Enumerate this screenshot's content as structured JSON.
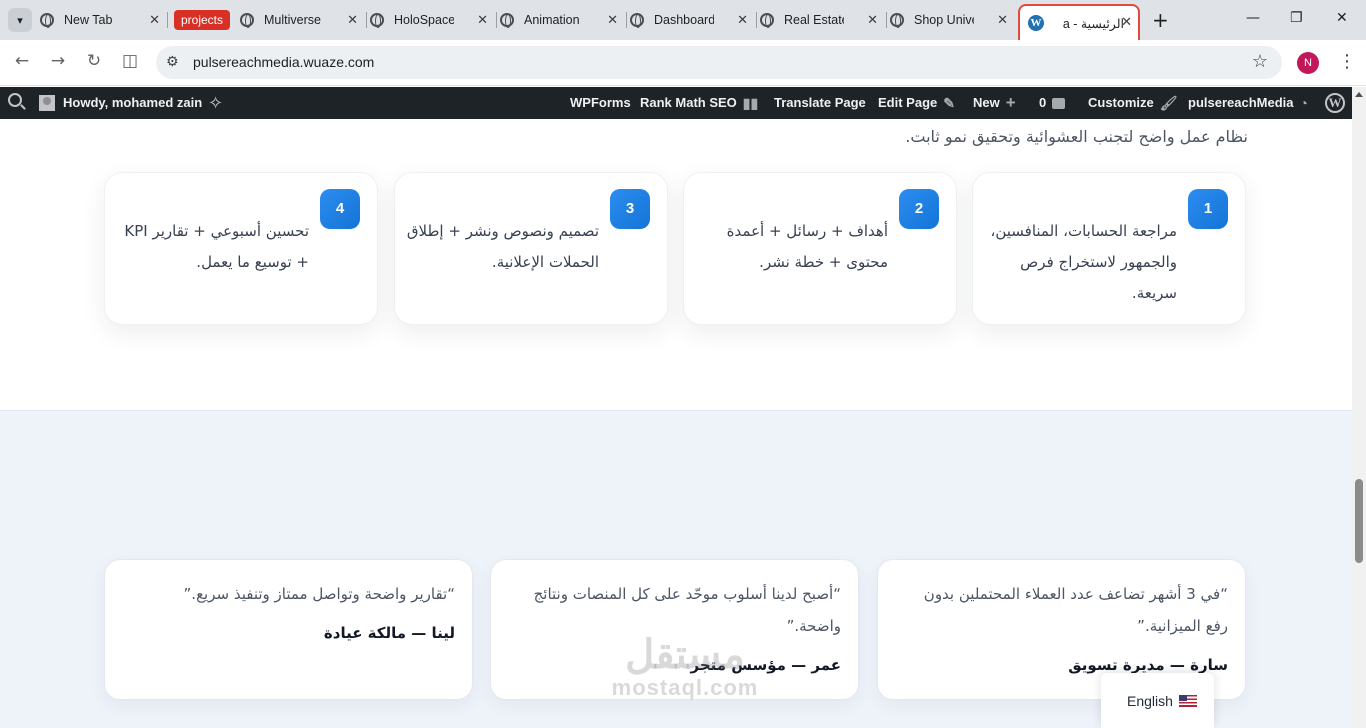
{
  "browser": {
    "tabs": [
      {
        "title": "New Tab"
      },
      {
        "title": "Multiverse"
      },
      {
        "title": "HoloSpace"
      },
      {
        "title": "Animation"
      },
      {
        "title": "Dashboard"
      },
      {
        "title": "Real Estate"
      },
      {
        "title": "Shop Unive"
      },
      {
        "title": "الرئيسية - a",
        "active": true
      }
    ],
    "group_chip": "projects",
    "new_tab": "+",
    "url": "pulsereachmedia.wuaze.com",
    "profile_initial": "N"
  },
  "adminbar": {
    "howdy": "Howdy, mohamed zain",
    "wpforms": "WPForms",
    "rankmath": "Rank Math SEO",
    "translate": "Translate Page",
    "edit": "Edit Page",
    "new": "New",
    "comments_count": "0",
    "customize": "Customize",
    "site": "pulsereachMedia"
  },
  "process": {
    "intro": "نظام عمل واضح لتجنب العشوائية وتحقيق نمو ثابت.",
    "steps": [
      {
        "num": "1",
        "text": "مراجعة الحسابات، المنافسين، والجمهور لاستخراج فرص سريعة."
      },
      {
        "num": "2",
        "text": "أهداف + رسائل + أعمدة محتوى + خطة نشر."
      },
      {
        "num": "3",
        "text": "تصميم ونصوص ونشر + إطلاق الحملات الإعلانية."
      },
      {
        "num": "4",
        "text": "تحسين أسبوعي + تقارير KPI + توسيع ما يعمل."
      }
    ]
  },
  "testimonials": [
    {
      "quote": "“في 3 أشهر تضاعف عدد العملاء المحتملين بدون رفع الميزانية.”",
      "author": "سارة — مديرة تسويق"
    },
    {
      "quote": "“أصبح لدينا أسلوب موحّد على كل المنصات ونتائج واضحة.”",
      "author": "عمر — مؤسس متجر"
    },
    {
      "quote": "“تقارير واضحة وتواصل ممتاز وتنفيذ سريع.”",
      "author": "لينا — مالكة عيادة"
    }
  ],
  "watermark": {
    "arabic": "مستقل",
    "latin": "mostaql.com"
  },
  "language": {
    "label": "English"
  },
  "colors": {
    "accent": "#1e88e5",
    "adminbar": "#1d2327",
    "band": "#eef2f9",
    "active_tab_border": "#e24a3b"
  }
}
